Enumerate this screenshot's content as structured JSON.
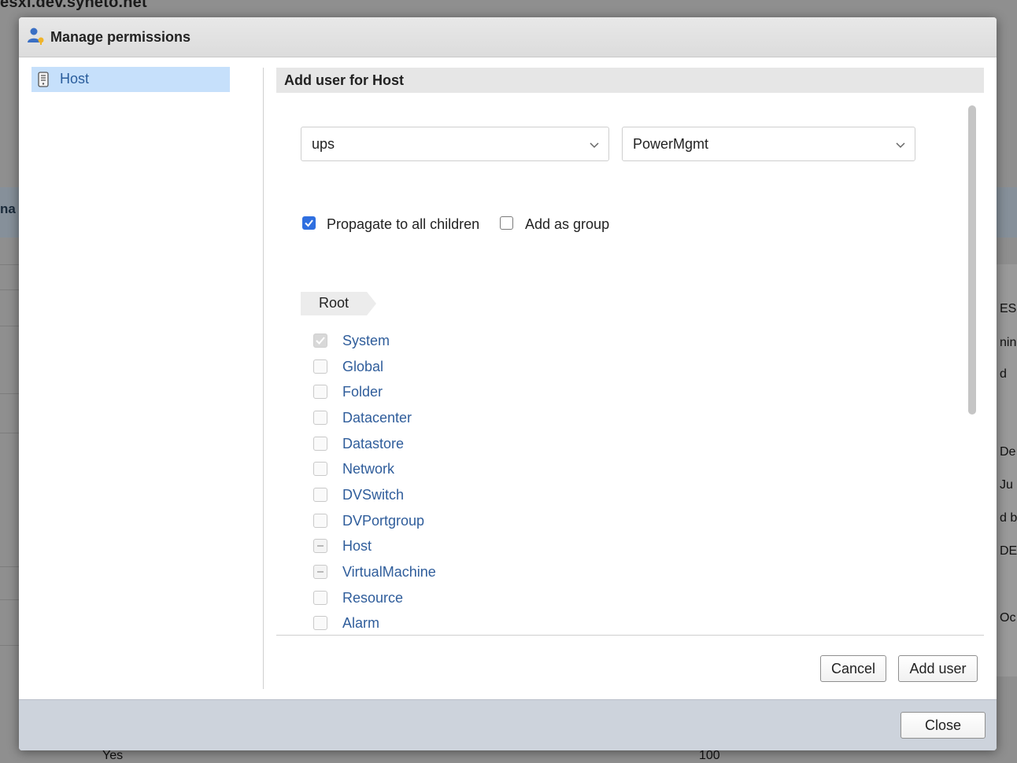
{
  "background": {
    "host_title": "esxi.dev.syneto.net",
    "band_text": "na",
    "right_fragments": [
      "ES",
      "nin",
      "d",
      "De",
      "Ju",
      "d b",
      "DE",
      "Oc"
    ],
    "bottom_left": "Yes",
    "bottom_right": "100"
  },
  "dialog": {
    "title": "Manage permissions",
    "tree": {
      "items": [
        {
          "label": "Host",
          "icon": "host-server-icon",
          "selected": true
        }
      ]
    },
    "section_title": "Add user for Host",
    "user_select": {
      "value": "ups"
    },
    "role_select": {
      "value": "PowerMgmt"
    },
    "options": {
      "propagate": {
        "label": "Propagate to all children",
        "checked": true
      },
      "add_as_group": {
        "label": "Add as group",
        "checked": false
      }
    },
    "breadcrumb": {
      "label": "Root"
    },
    "privileges": [
      {
        "label": "System",
        "state": "checked-disabled"
      },
      {
        "label": "Global",
        "state": "unchecked"
      },
      {
        "label": "Folder",
        "state": "unchecked"
      },
      {
        "label": "Datacenter",
        "state": "unchecked"
      },
      {
        "label": "Datastore",
        "state": "unchecked"
      },
      {
        "label": "Network",
        "state": "unchecked"
      },
      {
        "label": "DVSwitch",
        "state": "unchecked"
      },
      {
        "label": "DVPortgroup",
        "state": "unchecked"
      },
      {
        "label": "Host",
        "state": "partial"
      },
      {
        "label": "VirtualMachine",
        "state": "partial"
      },
      {
        "label": "Resource",
        "state": "unchecked"
      },
      {
        "label": "Alarm",
        "state": "unchecked"
      }
    ],
    "buttons": {
      "cancel": "Cancel",
      "add_user": "Add user",
      "close": "Close"
    }
  },
  "colors": {
    "accent_blue": "#2f6fe0",
    "link_blue": "#2f5d9b",
    "selection_bg": "#c6e0fb",
    "footer_bg": "#cdd3dc"
  }
}
